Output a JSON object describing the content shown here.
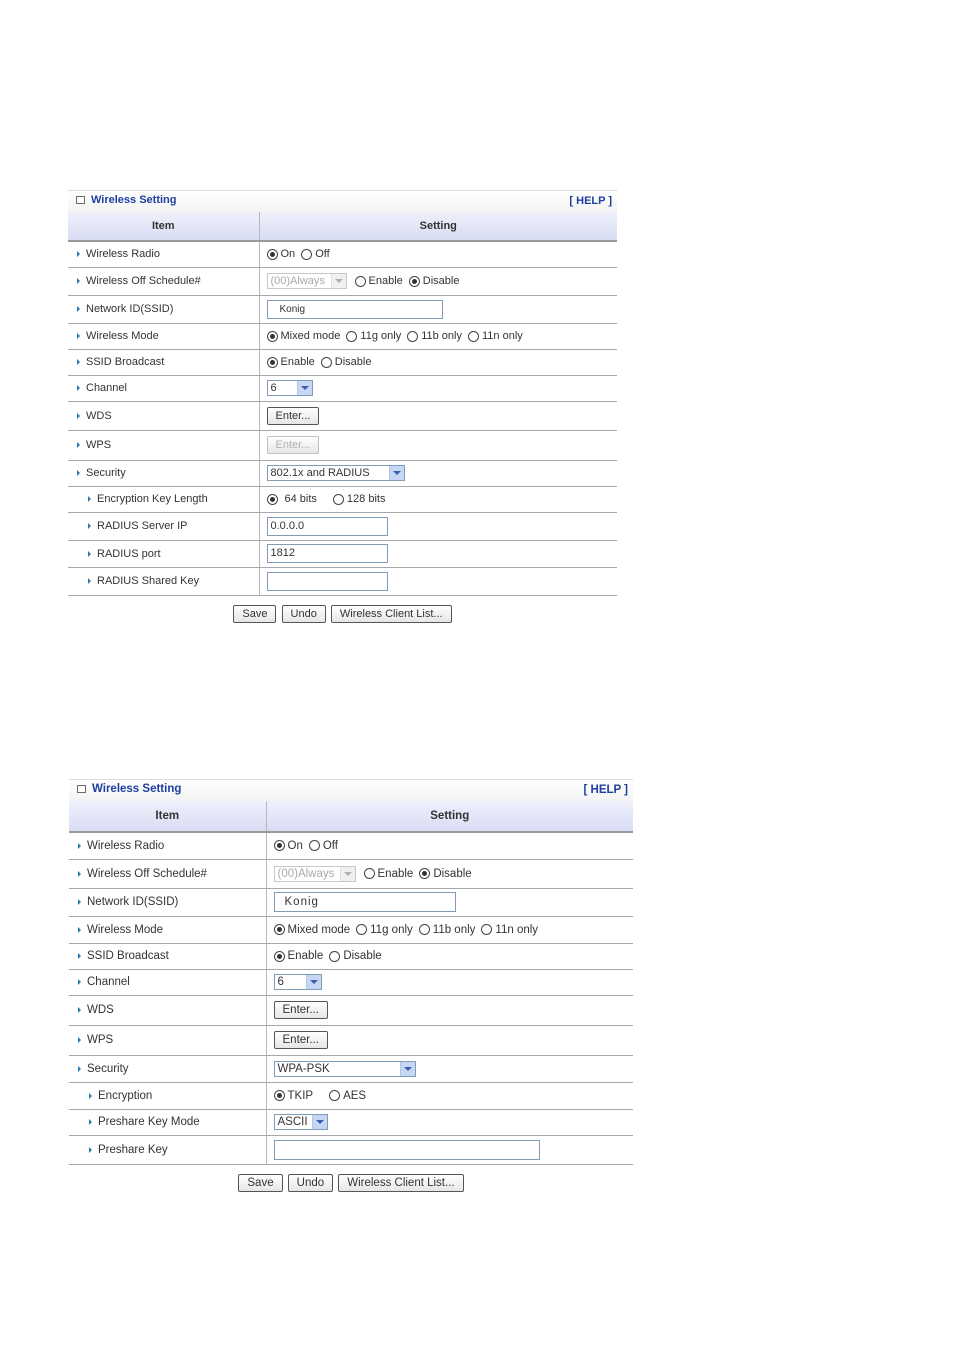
{
  "panel1": {
    "title": "Wireless Setting",
    "help": "[ HELP ]",
    "col_item": "Item",
    "col_setting": "Setting",
    "rows": {
      "radio": {
        "label": "Wireless Radio",
        "on": "On",
        "off": "Off",
        "selected": "On"
      },
      "schedule": {
        "label": "Wireless Off Schedule#",
        "select": "(00)Always",
        "enable": "Enable",
        "disable": "Disable",
        "selected": "Disable"
      },
      "ssid": {
        "label": "Network ID(SSID)",
        "value": "Konig"
      },
      "mode": {
        "label": "Wireless Mode",
        "opt1": "Mixed mode",
        "opt2": "11g only",
        "opt3": "11b only",
        "opt4": "11n only",
        "selected": "Mixed mode"
      },
      "broadcast": {
        "label": "SSID Broadcast",
        "enable": "Enable",
        "disable": "Disable",
        "selected": "Enable"
      },
      "channel": {
        "label": "Channel",
        "value": "6"
      },
      "wds": {
        "label": "WDS",
        "button": "Enter..."
      },
      "wps": {
        "label": "WPS",
        "button": "Enter..."
      },
      "security": {
        "label": "Security",
        "value": "802.1x and RADIUS"
      },
      "keylen": {
        "label": "Encryption Key Length",
        "opt1": "64 bits",
        "opt2": "128 bits",
        "selected": "64 bits"
      },
      "radius_ip": {
        "label": "RADIUS Server IP",
        "value": "0.0.0.0"
      },
      "radius_port": {
        "label": "RADIUS port",
        "value": "1812"
      },
      "radius_key": {
        "label": "RADIUS Shared Key",
        "value": ""
      }
    },
    "buttons": {
      "save": "Save",
      "undo": "Undo",
      "client_list": "Wireless Client List..."
    }
  },
  "panel2": {
    "title": "Wireless Setting",
    "help": "[ HELP ]",
    "col_item": "Item",
    "col_setting": "Setting",
    "rows": {
      "radio": {
        "label": "Wireless Radio",
        "on": "On",
        "off": "Off",
        "selected": "On"
      },
      "schedule": {
        "label": "Wireless Off Schedule#",
        "select": "(00)Always",
        "enable": "Enable",
        "disable": "Disable",
        "selected": "Disable"
      },
      "ssid": {
        "label": "Network ID(SSID)",
        "value": "Konig"
      },
      "mode": {
        "label": "Wireless Mode",
        "opt1": "Mixed mode",
        "opt2": "11g only",
        "opt3": "11b only",
        "opt4": "11n only",
        "selected": "Mixed mode"
      },
      "broadcast": {
        "label": "SSID Broadcast",
        "enable": "Enable",
        "disable": "Disable",
        "selected": "Enable"
      },
      "channel": {
        "label": "Channel",
        "value": "6"
      },
      "wds": {
        "label": "WDS",
        "button": "Enter..."
      },
      "wps": {
        "label": "WPS",
        "button": "Enter..."
      },
      "security": {
        "label": "Security",
        "value": "WPA-PSK"
      },
      "encryption": {
        "label": "Encryption",
        "opt1": "TKIP",
        "opt2": "AES",
        "selected": "TKIP"
      },
      "psk_mode": {
        "label": "Preshare Key Mode",
        "value": "ASCII"
      },
      "psk": {
        "label": "Preshare Key",
        "value": ""
      }
    },
    "buttons": {
      "save": "Save",
      "undo": "Undo",
      "client_list": "Wireless Client List..."
    }
  }
}
